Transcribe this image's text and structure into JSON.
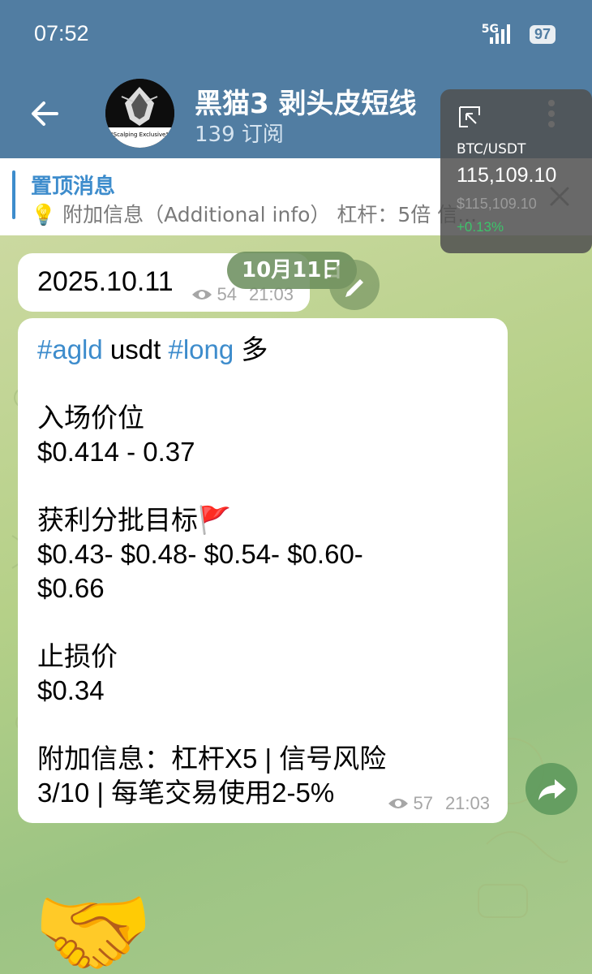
{
  "status_bar": {
    "time": "07:52",
    "network": "5G",
    "battery": "97"
  },
  "header": {
    "channel_name": "黑猫3 剥头皮短线",
    "subscribers": "139 订阅",
    "avatar_caption": "\"Scalping Exclusive\""
  },
  "pinned": {
    "title": "置顶消息",
    "text": "💡 附加信息（Additional info） 杠杆：5倍 信..."
  },
  "messages": [
    {
      "text": "2025.10.11",
      "views": "54",
      "time": "21:03"
    },
    {
      "tag1": "#agld",
      "word1": " usdt ",
      "tag2": "#long",
      "word2": " 多",
      "body": "入场价位\n$0.414 - 0.37\n\n获利分批目标🚩\n$0.43- $0.48- $0.54- $0.60-\n$0.66\n\n止损价\n$0.34\n\n附加信息：杠杆X5 | 信号风险\n3/10 | 每笔交易使用2-5%",
      "views": "57",
      "time": "21:03"
    }
  ],
  "date_chip": "10月11日",
  "price_overlay": {
    "pair": "BTC/USDT",
    "price": "115,109.10",
    "sub_price": "$115,109.10",
    "change": "+0.13%",
    "change_color": "#3cc46a"
  },
  "sticker": {
    "emoji": "🤝"
  },
  "colors": {
    "header": "#517da2",
    "accent": "#3d8ccc"
  }
}
